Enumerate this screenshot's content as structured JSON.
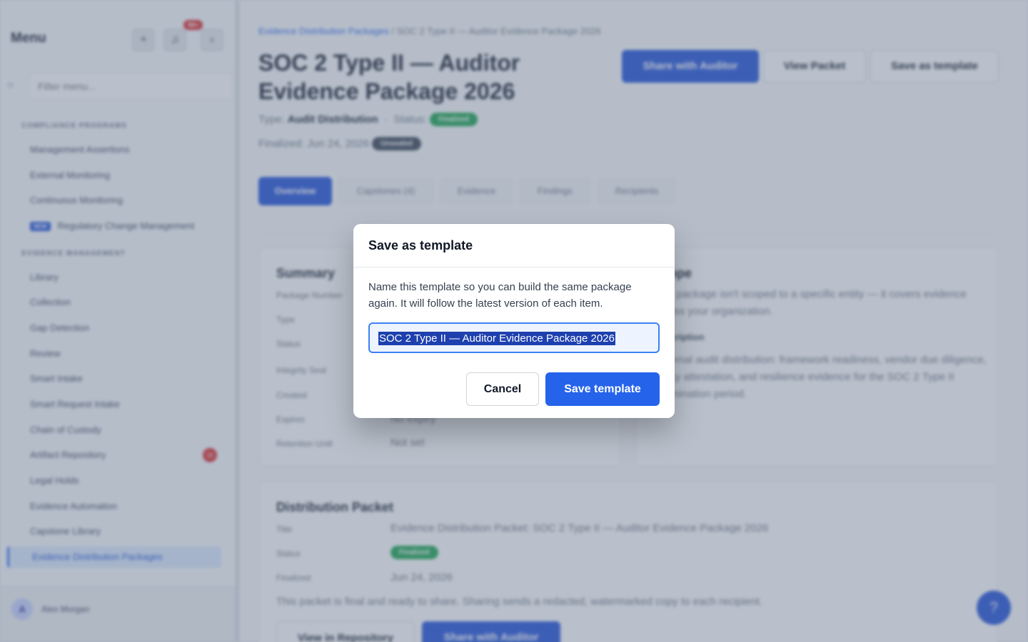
{
  "sidebar": {
    "title": "Menu",
    "add_icon": "plus-icon",
    "bell_icon": "bell-icon",
    "notification_count": "99+",
    "collapse_icon": "chevron-left-icon",
    "search_placeholder": "Filter menu...",
    "sections": [
      {
        "label": "Compliance Programs"
      },
      {
        "label": "Evidence Management"
      }
    ],
    "compliance_items": [
      "Management Assertions",
      "External Monitoring",
      "Continuous Monitoring"
    ],
    "new_tag": "NEW",
    "new_item": "Regulatory Change Management",
    "evidence_items": [
      "Library",
      "Collection",
      "Gap Detection",
      "Review",
      "Smart Intake",
      "Smart Request Intake",
      "Chain of Custody",
      "Artifact Repository",
      "Legal Holds",
      "Evidence Automation",
      "Capstone Library"
    ],
    "artifact_count": "16",
    "active_item": "Evidence Distribution Packages",
    "user_initial": "A",
    "user_name": "Alex Morgan"
  },
  "header": {
    "breadcrumb_link": "Evidence Distribution Packages",
    "breadcrumb_sep": "/",
    "breadcrumb_current": "SOC 2 Type II — Auditor Evidence Package 2026",
    "title": "SOC 2 Type II — Auditor Evidence Package 2026",
    "type_label": "Type:",
    "type_value": "Audit Distribution",
    "status_label": "Status:",
    "status_value": "Finalized",
    "finalized_label": "Finalized: Jun 24, 2026",
    "unsealed_badge": "Unsealed",
    "share_button": "Share with Auditor",
    "view_packet_button": "View Packet",
    "save_template_button": "Save as template"
  },
  "tabs": [
    "Overview",
    "Capstones (4)",
    "Evidence",
    "Findings",
    "Recipients"
  ],
  "summary": {
    "title": "Summary",
    "rows": [
      {
        "key": "Package Number",
        "value": ""
      },
      {
        "key": "Type",
        "value": ""
      },
      {
        "key": "Status",
        "value": ""
      },
      {
        "key": "Integrity Seal",
        "value": ""
      },
      {
        "key": "Created",
        "value": ""
      },
      {
        "key": "Expires",
        "value": "No expiry"
      },
      {
        "key": "Retention Until",
        "value": "Not set"
      }
    ]
  },
  "scope": {
    "title": "Scope",
    "text": "This package isn't scoped to a specific entity — it covers evidence across your organization.",
    "description_label": "Description",
    "description": "External audit distribution: framework readiness, vendor due diligence, policy attestation, and resilience evidence for the SOC 2 Type II examination period."
  },
  "packet": {
    "title": "Distribution Packet",
    "title_key": "Title",
    "title_value": "Evidence Distribution Packet: SOC 2 Type II — Auditor Evidence Package 2026",
    "status_key": "Status",
    "status_value": "Finalized",
    "finalized_key": "Finalized",
    "finalized_value": "Jun 24, 2026",
    "note": "This packet is final and ready to share. Sharing sends a redacted, watermarked copy to each recipient.",
    "view_repo_button": "View in Repository",
    "share_button": "Share with Auditor"
  },
  "help_icon": "help-icon",
  "modal": {
    "title": "Save as template",
    "description": "Name this template so you can build the same package again. It will follow the latest version of each item.",
    "input_value": "SOC 2 Type II — Auditor Evidence Package 2026",
    "cancel_label": "Cancel",
    "save_label": "Save template"
  }
}
